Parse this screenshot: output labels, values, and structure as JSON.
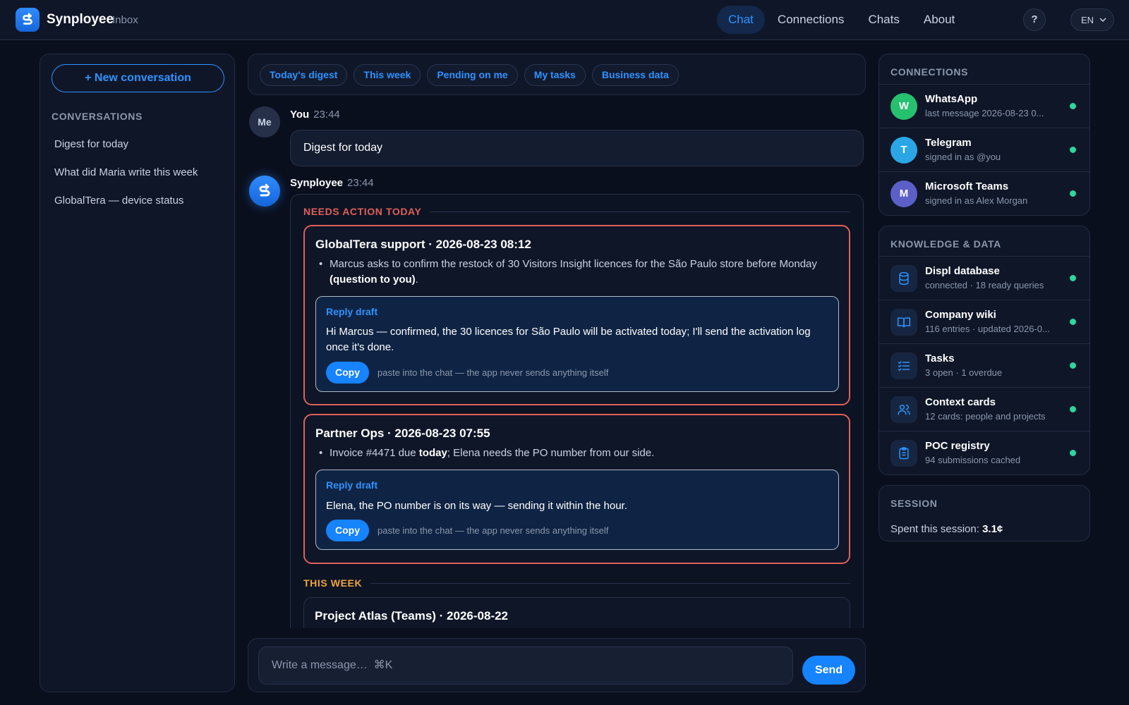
{
  "header": {
    "brand": "Synployee",
    "brand_sub": "Inbox",
    "nav": [
      {
        "label": "Chat",
        "active": true
      },
      {
        "label": "Connections",
        "active": false
      },
      {
        "label": "Chats",
        "active": false
      },
      {
        "label": "About",
        "active": false
      }
    ],
    "help_label": "?",
    "lang": "EN"
  },
  "sidebar": {
    "new_button": "+ New conversation",
    "section_title": "CONVERSATIONS",
    "items": [
      "Digest for today",
      "What did Maria write this week",
      "GlobalTera — device status"
    ]
  },
  "chips": [
    "Today's digest",
    "This week",
    "Pending on me",
    "My tasks",
    "Business data"
  ],
  "user_message": {
    "avatar": "Me",
    "sender": "You",
    "time": "23:44",
    "text": "Digest for today"
  },
  "bot_message": {
    "sender": "Synployee",
    "time": "23:44",
    "needs_action_title": "NEEDS ACTION TODAY",
    "this_week_title": "THIS WEEK",
    "cards": [
      {
        "title": "GlobalTera support · 2026-08-23 08:12",
        "bullet_pre": "Marcus asks to confirm the restock of 30 Visitors Insight licences for the São Paulo store before Monday ",
        "bullet_bold": "(question to you)",
        "bullet_post": ".",
        "draft_label": "Reply draft",
        "draft_text": "Hi Marcus — confirmed, the 30 licences for São Paulo will be activated today; I'll send the activation log once it's done.",
        "copy_label": "Copy",
        "copy_note": "paste into the chat — the app never sends anything itself"
      },
      {
        "title": "Partner Ops · 2026-08-23 07:55",
        "bullet_pre": "Invoice #4471 due ",
        "bullet_bold": "today",
        "bullet_post": "; Elena needs the PO number from our side.",
        "draft_label": "Reply draft",
        "draft_text": "Elena, the PO number is on its way — sending it within the hour.",
        "copy_label": "Copy",
        "copy_note": "paste into the chat — the app never sends anything itself"
      }
    ],
    "week_card_title": "Project Atlas (Teams) · 2026-08-22"
  },
  "composer": {
    "placeholder": "Write a message…  ⌘K",
    "send_label": "Send"
  },
  "connections": {
    "title": "CONNECTIONS",
    "items": [
      {
        "initial": "W",
        "name": "WhatsApp",
        "sub": "last message 2026-08-23 0...",
        "color": "#25c16f"
      },
      {
        "initial": "T",
        "name": "Telegram",
        "sub": "signed in as @you",
        "color": "#2aa6e6"
      },
      {
        "initial": "M",
        "name": "Microsoft Teams",
        "sub": "signed in as Alex Morgan",
        "color": "#5b5fc7"
      }
    ]
  },
  "knowledge": {
    "title": "KNOWLEDGE & DATA",
    "items": [
      {
        "icon": "database-icon",
        "name": "Displ database",
        "sub": "connected · 18 ready queries"
      },
      {
        "icon": "book-icon",
        "name": "Company wiki",
        "sub": "116 entries · updated 2026-0..."
      },
      {
        "icon": "checklist-icon",
        "name": "Tasks",
        "sub": "3 open · 1 overdue"
      },
      {
        "icon": "people-icon",
        "name": "Context cards",
        "sub": "12 cards: people and projects"
      },
      {
        "icon": "clipboard-icon",
        "name": "POC registry",
        "sub": "94 submissions cached"
      }
    ]
  },
  "session": {
    "title": "SESSION",
    "label": "Spent this session:",
    "value": "3.1¢"
  },
  "colors": {
    "accent": "#2e93ff",
    "urgent": "#e0605a",
    "week": "#f0a53a",
    "status_ok": "#2fd4a0"
  }
}
